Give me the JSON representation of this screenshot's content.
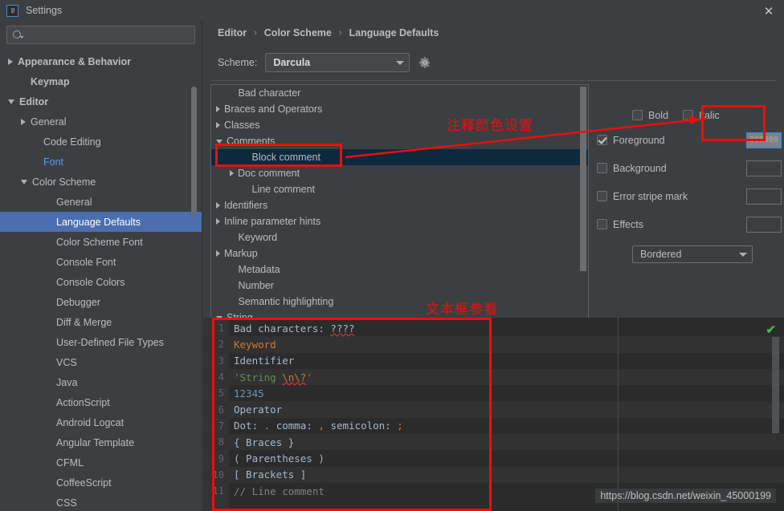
{
  "window": {
    "title": "Settings",
    "logo_text": "IJ",
    "close_label": "✕"
  },
  "sidebar": {
    "search": {
      "value": "",
      "placeholder": ""
    },
    "items": [
      {
        "label": "Appearance & Behavior",
        "indent": 0,
        "arrow": "right",
        "bold": true,
        "state": "normal"
      },
      {
        "label": "Keymap",
        "indent": 1,
        "arrow": "none",
        "bold": true,
        "state": "normal"
      },
      {
        "label": "Editor",
        "indent": 0,
        "arrow": "down",
        "bold": true,
        "state": "normal"
      },
      {
        "label": "General",
        "indent": 1,
        "arrow": "right",
        "bold": false,
        "state": "normal"
      },
      {
        "label": "Code Editing",
        "indent": 2,
        "arrow": "none",
        "bold": false,
        "state": "normal"
      },
      {
        "label": "Font",
        "indent": 2,
        "arrow": "none",
        "bold": false,
        "state": "link"
      },
      {
        "label": "Color Scheme",
        "indent": 1,
        "arrow": "down",
        "bold": false,
        "state": "normal"
      },
      {
        "label": "General",
        "indent": 3,
        "arrow": "none",
        "bold": false,
        "state": "normal"
      },
      {
        "label": "Language Defaults",
        "indent": 3,
        "arrow": "none",
        "bold": false,
        "state": "selected"
      },
      {
        "label": "Color Scheme Font",
        "indent": 3,
        "arrow": "none",
        "bold": false,
        "state": "normal"
      },
      {
        "label": "Console Font",
        "indent": 3,
        "arrow": "none",
        "bold": false,
        "state": "normal"
      },
      {
        "label": "Console Colors",
        "indent": 3,
        "arrow": "none",
        "bold": false,
        "state": "normal"
      },
      {
        "label": "Debugger",
        "indent": 3,
        "arrow": "none",
        "bold": false,
        "state": "normal"
      },
      {
        "label": "Diff & Merge",
        "indent": 3,
        "arrow": "none",
        "bold": false,
        "state": "normal"
      },
      {
        "label": "User-Defined File Types",
        "indent": 3,
        "arrow": "none",
        "bold": false,
        "state": "normal"
      },
      {
        "label": "VCS",
        "indent": 3,
        "arrow": "none",
        "bold": false,
        "state": "normal"
      },
      {
        "label": "Java",
        "indent": 3,
        "arrow": "none",
        "bold": false,
        "state": "normal"
      },
      {
        "label": "ActionScript",
        "indent": 3,
        "arrow": "none",
        "bold": false,
        "state": "normal"
      },
      {
        "label": "Android Logcat",
        "indent": 3,
        "arrow": "none",
        "bold": false,
        "state": "normal"
      },
      {
        "label": "Angular Template",
        "indent": 3,
        "arrow": "none",
        "bold": false,
        "state": "normal"
      },
      {
        "label": "CFML",
        "indent": 3,
        "arrow": "none",
        "bold": false,
        "state": "normal"
      },
      {
        "label": "CoffeeScript",
        "indent": 3,
        "arrow": "none",
        "bold": false,
        "state": "normal"
      },
      {
        "label": "CSS",
        "indent": 3,
        "arrow": "none",
        "bold": false,
        "state": "normal"
      }
    ]
  },
  "breadcrumb": {
    "items": [
      "Editor",
      "Color Scheme",
      "Language Defaults"
    ],
    "separator": "›"
  },
  "scheme": {
    "label": "Scheme:",
    "value": "Darcula",
    "gear_icon": "gear-icon"
  },
  "attributes": {
    "items": [
      {
        "label": "Bad character",
        "indent": 1,
        "arrow": "none",
        "state": "normal"
      },
      {
        "label": "Braces and Operators",
        "indent": 0,
        "arrow": "right",
        "state": "normal"
      },
      {
        "label": "Classes",
        "indent": 0,
        "arrow": "right",
        "state": "normal"
      },
      {
        "label": "Comments",
        "indent": 0,
        "arrow": "down",
        "state": "normal"
      },
      {
        "label": "Block comment",
        "indent": 2,
        "arrow": "none",
        "state": "selected"
      },
      {
        "label": "Doc comment",
        "indent": 1,
        "arrow": "right",
        "state": "normal"
      },
      {
        "label": "Line comment",
        "indent": 2,
        "arrow": "none",
        "state": "normal"
      },
      {
        "label": "Identifiers",
        "indent": 0,
        "arrow": "right",
        "state": "normal"
      },
      {
        "label": "Inline parameter hints",
        "indent": 0,
        "arrow": "right",
        "state": "normal"
      },
      {
        "label": "Keyword",
        "indent": 1,
        "arrow": "none",
        "state": "normal"
      },
      {
        "label": "Markup",
        "indent": 0,
        "arrow": "right",
        "state": "normal"
      },
      {
        "label": "Metadata",
        "indent": 1,
        "arrow": "none",
        "state": "normal"
      },
      {
        "label": "Number",
        "indent": 1,
        "arrow": "none",
        "state": "normal"
      },
      {
        "label": "Semantic highlighting",
        "indent": 1,
        "arrow": "none",
        "state": "normal"
      },
      {
        "label": "String",
        "indent": 0,
        "arrow": "down",
        "state": "normal"
      }
    ]
  },
  "options": {
    "bold": {
      "label": "Bold",
      "checked": false
    },
    "italic": {
      "label": "Italic",
      "checked": false
    },
    "rows": [
      {
        "label": "Foreground",
        "checked": true,
        "swatch_value": "808080",
        "swatch_color": "#808080",
        "filled": true
      },
      {
        "label": "Background",
        "checked": false,
        "swatch_value": "",
        "swatch_color": "",
        "filled": false
      },
      {
        "label": "Error stripe mark",
        "checked": false,
        "swatch_value": "",
        "swatch_color": "",
        "filled": false
      },
      {
        "label": "Effects",
        "checked": false,
        "swatch_value": "",
        "swatch_color": "",
        "filled": false
      }
    ],
    "effect_type": "Bordered"
  },
  "preview": {
    "lines": [
      {
        "no": "1",
        "segments": [
          {
            "t": "Bad characters: ",
            "c": "#a9b7c6"
          },
          {
            "t": "????",
            "c": "#a9b7c6",
            "underline": true
          }
        ]
      },
      {
        "no": "2",
        "segments": [
          {
            "t": "Keyword",
            "c": "#cc7832"
          }
        ]
      },
      {
        "no": "3",
        "segments": [
          {
            "t": "Identifier",
            "c": "#a9b7c6"
          }
        ]
      },
      {
        "no": "4",
        "segments": [
          {
            "t": "'String ",
            "c": "#6a8759"
          },
          {
            "t": "\\n\\?",
            "c": "#cc7832",
            "underline": true
          },
          {
            "t": "'",
            "c": "#6a8759"
          }
        ]
      },
      {
        "no": "5",
        "segments": [
          {
            "t": "12345",
            "c": "#6897bb"
          }
        ]
      },
      {
        "no": "6",
        "segments": [
          {
            "t": "Operator",
            "c": "#a9b7c6"
          }
        ]
      },
      {
        "no": "7",
        "segments": [
          {
            "t": "Dot: ",
            "c": "#a9b7c6"
          },
          {
            "t": ".",
            "c": "#cc7832"
          },
          {
            "t": " comma: ",
            "c": "#a9b7c6"
          },
          {
            "t": ",",
            "c": "#cc7832"
          },
          {
            "t": " semicolon: ",
            "c": "#a9b7c6"
          },
          {
            "t": ";",
            "c": "#cc7832"
          }
        ]
      },
      {
        "no": "8",
        "segments": [
          {
            "t": "{ Braces }",
            "c": "#a9b7c6"
          }
        ]
      },
      {
        "no": "9",
        "segments": [
          {
            "t": "( Parentheses )",
            "c": "#a9b7c6"
          }
        ]
      },
      {
        "no": "10",
        "segments": [
          {
            "t": "[ Brackets ]",
            "c": "#a9b7c6"
          }
        ]
      },
      {
        "no": "11",
        "segments": [
          {
            "t": "// Line comment",
            "c": "#808080"
          }
        ]
      }
    ],
    "status_icon": "✔",
    "status_color": "#4caf50"
  },
  "annotations": {
    "comment_color_setting": "注释颜色设置",
    "textbox_reference": "文本框参看",
    "color": "#ee0d0d"
  },
  "watermark": {
    "url": "https://blog.csdn.net/weixin_45000199"
  }
}
